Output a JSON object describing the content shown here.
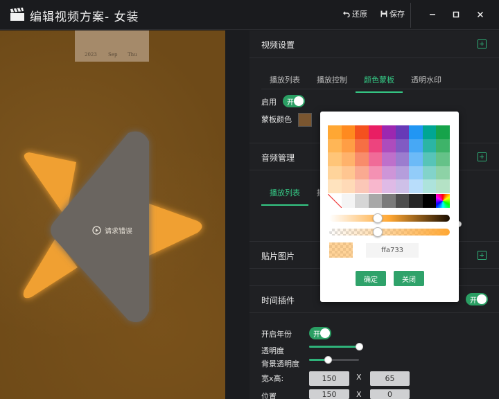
{
  "window": {
    "title": "编辑视频方案- 女装",
    "restore_label": "还原",
    "save_label": "保存"
  },
  "preview": {
    "date_text": [
      "2023",
      "Sep",
      "Thu"
    ],
    "error_text": "请求错误"
  },
  "sections": {
    "video_settings": "视频设置",
    "audio": "音频管理",
    "sticker": "贴片图片",
    "time_plugin": "时间插件"
  },
  "video_tabs": [
    "播放列表",
    "播放控制",
    "颜色蒙板",
    "透明水印"
  ],
  "video_tabs_active": 2,
  "audio_tabs": [
    "播放列表",
    "播"
  ],
  "mask": {
    "enable_label": "启用",
    "toggle_text": "开",
    "color_label": "蒙板颜色",
    "color": "#7a5630"
  },
  "time_plugin": {
    "toggle_text": "开",
    "year_label": "开启年份",
    "year_toggle_text": "开",
    "opacity_label": "透明度",
    "opacity_value": 1.0,
    "bg_opacity_label": "背景透明度",
    "bg_opacity_value": 0.38,
    "size_label": "宽x高:",
    "width": "150",
    "height": "65",
    "x_sep": "X",
    "pos_label": "位置",
    "pos_x": "150",
    "pos_y": "0"
  },
  "picker": {
    "hex": "ffa733",
    "confirm_label": "确定",
    "close_label": "关闭",
    "hue_value": 0.4,
    "alpha_value": 0.4
  },
  "colors": {
    "accent": "#2fb37a",
    "preview_bg": "#6e4a18",
    "logo": "#f0a030",
    "logo_center": "#6a6560"
  }
}
